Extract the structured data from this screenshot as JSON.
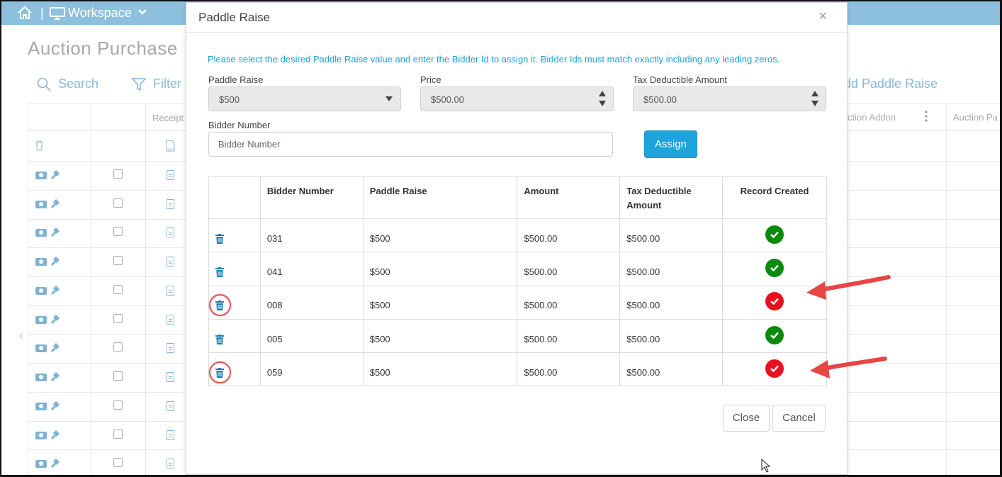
{
  "app": {
    "workspace_label": "Workspace",
    "separator": "|",
    "page_title": "Auction Purchase",
    "search_label": "Search",
    "filter_label": "Filter",
    "add_label": "dd Paddle Raise",
    "columns": [
      "Receipt",
      "ction Addon",
      "Auction Pa"
    ]
  },
  "modal": {
    "title": "Paddle Raise",
    "close_symbol": "×",
    "instructions": "Please select the desired Paddle Raise value and enter the Bidder Id to assign it. Bidder Ids must match exactly including any leading zeros.",
    "paddle_raise": {
      "label": "Paddle Raise",
      "value": "$500"
    },
    "price": {
      "label": "Price",
      "value": "$500.00"
    },
    "tax": {
      "label": "Tax Deductible Amount",
      "value": "$500.00"
    },
    "bidder": {
      "label": "Bidder Number",
      "placeholder": "Bidder Number"
    },
    "assign_label": "Assign",
    "table": {
      "headers": [
        "",
        "Bidder Number",
        "Paddle Raise",
        "Amount",
        "Tax Deductible Amount",
        "Record Created"
      ],
      "rows": [
        {
          "bidder": "031",
          "paddle": "$500",
          "amount": "$500.00",
          "tax": "$500.00",
          "status": "success"
        },
        {
          "bidder": "041",
          "paddle": "$500",
          "amount": "$500.00",
          "tax": "$500.00",
          "status": "success"
        },
        {
          "bidder": "008",
          "paddle": "$500",
          "amount": "$500.00",
          "tax": "$500.00",
          "status": "error"
        },
        {
          "bidder": "005",
          "paddle": "$500",
          "amount": "$500.00",
          "tax": "$500.00",
          "status": "success"
        },
        {
          "bidder": "059",
          "paddle": "$500",
          "amount": "$500.00",
          "tax": "$500.00",
          "status": "error"
        }
      ]
    },
    "close_label": "Close",
    "cancel_label": "Cancel"
  },
  "colors": {
    "success": "#0a8a0a",
    "error": "#e8101e",
    "accent": "#1ea3dc",
    "annotation": "#e84545"
  }
}
